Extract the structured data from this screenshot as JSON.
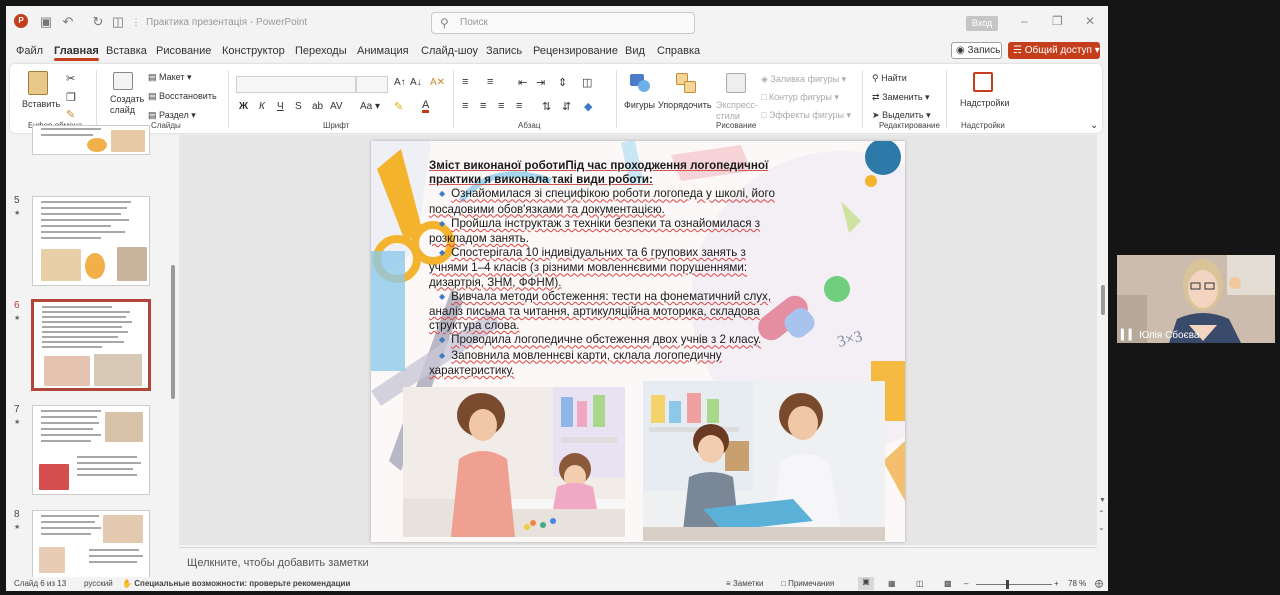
{
  "window": {
    "doc_title": "Практика презентація  -  PowerPoint",
    "search_placeholder": "Поиск",
    "login": "Вход"
  },
  "menu": {
    "tabs": [
      "Файл",
      "Главная",
      "Вставка",
      "Рисование",
      "Конструктор",
      "Переходы",
      "Анимация",
      "Слайд-шоу",
      "Запись",
      "Рецензирование",
      "Вид",
      "Справка"
    ],
    "active": "Главная",
    "record": "Запись",
    "share": "Общий доступ"
  },
  "ribbon": {
    "clipboard": {
      "paste": "Вставить",
      "label": "Буфер обмена"
    },
    "slides": {
      "new_slide": "Создать слайд",
      "layout": "Макет",
      "reset": "Восстановить",
      "section": "Раздел",
      "label": "Слайды"
    },
    "font": {
      "bold": "Ж",
      "italic": "К",
      "underline": "Ч",
      "strike": "S",
      "label": "Шрифт"
    },
    "paragraph": {
      "label": "Абзац"
    },
    "drawing": {
      "shapes": "Фигуры",
      "arrange": "Упорядочить",
      "quick_styles": "Экспресс-стили",
      "fill": "Заливка фигуры",
      "outline": "Контур фигуры",
      "effects": "Эффекты фигуры",
      "label": "Рисование"
    },
    "editing": {
      "find": "Найти",
      "replace": "Заменить",
      "select": "Выделить",
      "label": "Редактирование"
    },
    "addins": {
      "addins": "Надстройки",
      "label": "Надстройки"
    }
  },
  "thumbnails": [
    {
      "num": "5"
    },
    {
      "num": "6",
      "selected": true
    },
    {
      "num": "7"
    },
    {
      "num": "8"
    }
  ],
  "slide": {
    "title": "Зміст виконаної роботиПід час проходження логопедичної практики я виконала такі види роботи:",
    "bullets": [
      "Ознайомилася зі специфікою роботи логопеда у школі, його посадовими обов'язками та документацією.",
      "Пройшла інструктаж з техніки безпеки та ознайомилася з розкладом занять.",
      "Спостерігала 10 індивідуальних та 6 групових занять з учнями 1–4 класів (з різними мовленнєвими порушеннями: дизартрія, ЗНМ, ФФНМ).",
      "Вивчала методи обстеження: тести на фонематичний слух, аналіз письма та читання, артикуляційна моторика, складова структура слова.",
      "Проводила логопедичне обстеження двох учнів з 2 класу.",
      "Заповнила мовленнєві карти, склала логопедичну характеристику."
    ]
  },
  "notes_placeholder": "Щелкните, чтобы добавить заметки",
  "status": {
    "slide_counter": "Слайд 6 из 13",
    "language": "русский",
    "accessibility": "Специальные возможности: проверьте рекомендации",
    "notes": "Заметки",
    "comments": "Примечания",
    "zoom": "78 %"
  },
  "video": {
    "participant": "Юлія Сбоєва"
  },
  "colors": {
    "accent": "#c43e1c",
    "thumb_selected": "#b0453a",
    "bullet": "#3b78c9"
  }
}
